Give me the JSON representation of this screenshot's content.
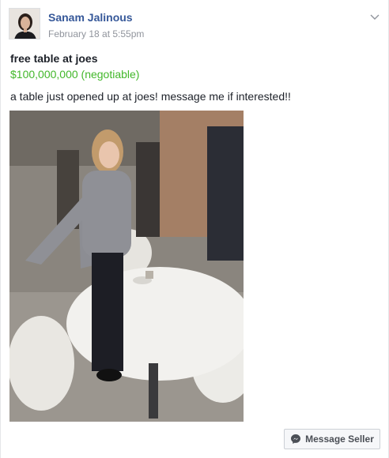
{
  "post": {
    "author": "Sanam Jalinous",
    "timestamp": "February 18 at 5:55pm",
    "options_icon": "chevron-down-icon"
  },
  "listing": {
    "title": "free table at joes",
    "price": "$100,000,000 (negotiable)",
    "description": "a table just opened up at joes! message me if interested!!",
    "price_color": "#42b72a"
  },
  "actions": {
    "message_seller_label": "Message Seller",
    "message_icon": "messenger-icon"
  },
  "colors": {
    "author_link": "#365899",
    "meta_text": "#90949c"
  }
}
